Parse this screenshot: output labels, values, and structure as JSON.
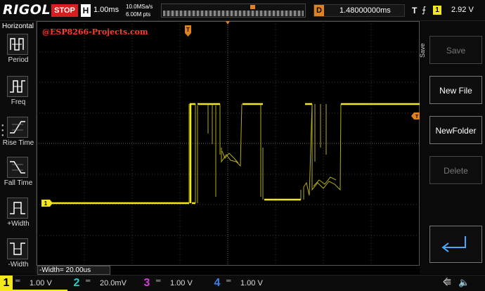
{
  "header": {
    "logo": "RIGOL",
    "run_state": "STOP",
    "timebase_letter": "H",
    "timebase": "1.00ms",
    "sample_rate": "10.0MSa/s",
    "memory_depth": "6.00M pts",
    "delay_letter": "D",
    "delay": "1.48000000ms",
    "trigger_letter": "T",
    "trigger_edge": "⨍",
    "trigger_channel": "1",
    "trigger_level": "2.92 V"
  },
  "left_menu": {
    "title": "Horizontal",
    "items": [
      {
        "label": "Period",
        "icon": "period-icon"
      },
      {
        "label": "Freq",
        "icon": "freq-icon"
      },
      {
        "label": "Rise Time",
        "icon": "rise-time-icon"
      },
      {
        "label": "Fall Time",
        "icon": "fall-time-icon"
      },
      {
        "label": "+Width",
        "icon": "pos-width-icon"
      },
      {
        "label": "-Width",
        "icon": "neg-width-icon"
      }
    ]
  },
  "screen": {
    "watermark": "@ESP8266-Projects.com",
    "trigger_pos_marker": "T",
    "ch1_marker": "1",
    "trigger_level_marker": "T",
    "measurement": "-Width= 20.00us"
  },
  "right_menu": {
    "title": "Save",
    "buttons": [
      {
        "label": "Save",
        "enabled": false
      },
      {
        "label": "New File",
        "enabled": true
      },
      {
        "label": "NewFolder",
        "enabled": true
      },
      {
        "label": "Delete",
        "enabled": false
      }
    ],
    "back_icon": "enter-return-icon"
  },
  "channels": [
    {
      "num": "1",
      "scale": "1.00 V",
      "coupling": "═",
      "color": "#f2e81c",
      "active": true
    },
    {
      "num": "2",
      "scale": "20.0mV",
      "coupling": "═",
      "color": "#2ec8c8",
      "active": false
    },
    {
      "num": "3",
      "scale": "1.00 V",
      "coupling": "═",
      "color": "#d53ed5",
      "active": false
    },
    {
      "num": "4",
      "scale": "1.00 V",
      "coupling": "═",
      "color": "#3f7fe6",
      "active": false
    }
  ],
  "status_icons": [
    "usb-icon",
    "speaker-icon"
  ],
  "colors": {
    "ch1": "#f2e81c",
    "stop": "#d81e1e",
    "trigger": "#e08020",
    "watermark": "#ff3b30"
  }
}
